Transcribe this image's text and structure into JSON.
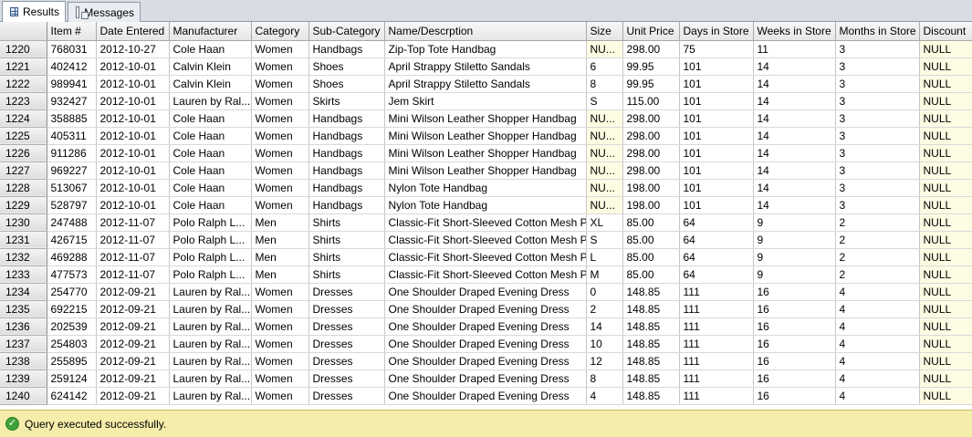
{
  "tabs": [
    {
      "label": "Results",
      "icon": "grid-icon",
      "active": true
    },
    {
      "label": "Messages",
      "icon": "messages-icon",
      "active": false
    }
  ],
  "grid": {
    "columns": [
      "",
      "Item #",
      "Date Entered",
      "Manufacturer",
      "Category",
      "Sub-Category",
      "Name/Descrption",
      "Size",
      "Unit Price",
      "Days in Store",
      "Weeks in Store",
      "Months in Store",
      "Discount"
    ],
    "rows": [
      [
        "1220",
        "768031",
        "2012-10-27",
        "Cole Haan",
        "Women",
        "Handbags",
        "Zip-Top Tote Handbag",
        "NU...",
        "298.00",
        "75",
        "11",
        "3",
        "NULL"
      ],
      [
        "1221",
        "402412",
        "2012-10-01",
        "Calvin Klein",
        "Women",
        "Shoes",
        "April Strappy Stiletto Sandals",
        "6",
        "99.95",
        "101",
        "14",
        "3",
        "NULL"
      ],
      [
        "1222",
        "989941",
        "2012-10-01",
        "Calvin Klein",
        "Women",
        "Shoes",
        "April Strappy Stiletto Sandals",
        "8",
        "99.95",
        "101",
        "14",
        "3",
        "NULL"
      ],
      [
        "1223",
        "932427",
        "2012-10-01",
        "Lauren by Ral...",
        "Women",
        "Skirts",
        "Jem Skirt",
        "S",
        "115.00",
        "101",
        "14",
        "3",
        "NULL"
      ],
      [
        "1224",
        "358885",
        "2012-10-01",
        "Cole Haan",
        "Women",
        "Handbags",
        "Mini Wilson Leather Shopper Handbag",
        "NU...",
        "298.00",
        "101",
        "14",
        "3",
        "NULL"
      ],
      [
        "1225",
        "405311",
        "2012-10-01",
        "Cole Haan",
        "Women",
        "Handbags",
        "Mini Wilson Leather Shopper Handbag",
        "NU...",
        "298.00",
        "101",
        "14",
        "3",
        "NULL"
      ],
      [
        "1226",
        "911286",
        "2012-10-01",
        "Cole Haan",
        "Women",
        "Handbags",
        "Mini Wilson Leather Shopper Handbag",
        "NU...",
        "298.00",
        "101",
        "14",
        "3",
        "NULL"
      ],
      [
        "1227",
        "969227",
        "2012-10-01",
        "Cole Haan",
        "Women",
        "Handbags",
        "Mini Wilson Leather Shopper Handbag",
        "NU...",
        "298.00",
        "101",
        "14",
        "3",
        "NULL"
      ],
      [
        "1228",
        "513067",
        "2012-10-01",
        "Cole Haan",
        "Women",
        "Handbags",
        "Nylon Tote Handbag",
        "NU...",
        "198.00",
        "101",
        "14",
        "3",
        "NULL"
      ],
      [
        "1229",
        "528797",
        "2012-10-01",
        "Cole Haan",
        "Women",
        "Handbags",
        "Nylon Tote Handbag",
        "NU...",
        "198.00",
        "101",
        "14",
        "3",
        "NULL"
      ],
      [
        "1230",
        "247488",
        "2012-11-07",
        "Polo Ralph L...",
        "Men",
        "Shirts",
        "Classic-Fit Short-Sleeved Cotton Mesh Polo",
        "XL",
        "85.00",
        "64",
        "9",
        "2",
        "NULL"
      ],
      [
        "1231",
        "426715",
        "2012-11-07",
        "Polo Ralph L...",
        "Men",
        "Shirts",
        "Classic-Fit Short-Sleeved Cotton Mesh Polo",
        "S",
        "85.00",
        "64",
        "9",
        "2",
        "NULL"
      ],
      [
        "1232",
        "469288",
        "2012-11-07",
        "Polo Ralph L...",
        "Men",
        "Shirts",
        "Classic-Fit Short-Sleeved Cotton Mesh Polo",
        "L",
        "85.00",
        "64",
        "9",
        "2",
        "NULL"
      ],
      [
        "1233",
        "477573",
        "2012-11-07",
        "Polo Ralph L...",
        "Men",
        "Shirts",
        "Classic-Fit Short-Sleeved Cotton Mesh Polo",
        "M",
        "85.00",
        "64",
        "9",
        "2",
        "NULL"
      ],
      [
        "1234",
        "254770",
        "2012-09-21",
        "Lauren by Ral...",
        "Women",
        "Dresses",
        "One Shoulder Draped Evening Dress",
        "0",
        "148.85",
        "111",
        "16",
        "4",
        "NULL"
      ],
      [
        "1235",
        "692215",
        "2012-09-21",
        "Lauren by Ral...",
        "Women",
        "Dresses",
        "One Shoulder Draped Evening Dress",
        "2",
        "148.85",
        "111",
        "16",
        "4",
        "NULL"
      ],
      [
        "1236",
        "202539",
        "2012-09-21",
        "Lauren by Ral...",
        "Women",
        "Dresses",
        "One Shoulder Draped Evening Dress",
        "14",
        "148.85",
        "111",
        "16",
        "4",
        "NULL"
      ],
      [
        "1237",
        "254803",
        "2012-09-21",
        "Lauren by Ral...",
        "Women",
        "Dresses",
        "One Shoulder Draped Evening Dress",
        "10",
        "148.85",
        "111",
        "16",
        "4",
        "NULL"
      ],
      [
        "1238",
        "255895",
        "2012-09-21",
        "Lauren by Ral...",
        "Women",
        "Dresses",
        "One Shoulder Draped Evening Dress",
        "12",
        "148.85",
        "111",
        "16",
        "4",
        "NULL"
      ],
      [
        "1239",
        "259124",
        "2012-09-21",
        "Lauren by Ral...",
        "Women",
        "Dresses",
        "One Shoulder Draped Evening Dress",
        "8",
        "148.85",
        "111",
        "16",
        "4",
        "NULL"
      ],
      [
        "1240",
        "624142",
        "2012-09-21",
        "Lauren by Ral...",
        "Women",
        "Dresses",
        "One Shoulder Draped Evening Dress",
        "4",
        "148.85",
        "111",
        "16",
        "4",
        "NULL"
      ]
    ]
  },
  "status": {
    "icon": "success-check-icon",
    "text": "Query executed successfully.",
    "color": "#f5eeaa"
  }
}
